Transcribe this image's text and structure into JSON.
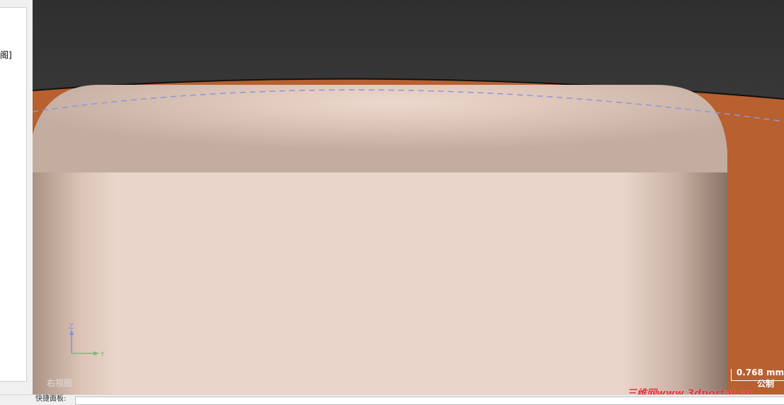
{
  "left_panel": {
    "text": "阁]"
  },
  "viewport": {
    "view_label": "右视图",
    "axis": {
      "z_label": "Z",
      "y_label": "Y"
    },
    "scale": {
      "value": "0.768 mm",
      "units": "公制"
    }
  },
  "bottom_bar": {
    "label": "快捷面板:"
  },
  "watermark": {
    "text": "三维网www.3dportal.cn"
  },
  "colors": {
    "body_color": "#e9d5ca",
    "background_surface": "#b8602f",
    "dashed_curve": "#8f97d8"
  }
}
